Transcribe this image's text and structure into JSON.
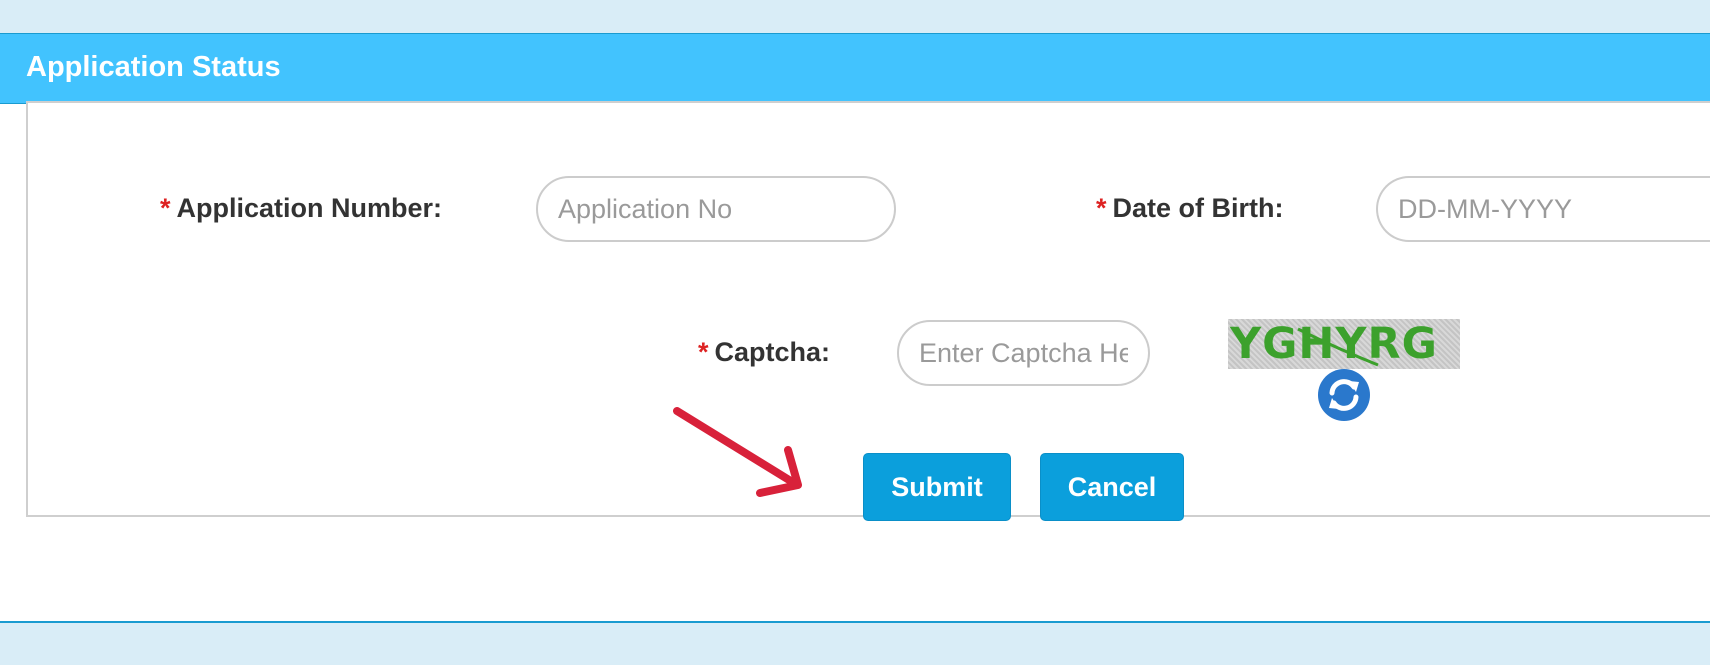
{
  "panel": {
    "title": "Application Status"
  },
  "form": {
    "required_marker": "*",
    "application_number": {
      "label": "Application Number:",
      "placeholder": "Application No",
      "value": ""
    },
    "date_of_birth": {
      "label": "Date of Birth:",
      "placeholder": "DD-MM-YYYY",
      "value": ""
    },
    "captcha": {
      "label": "Captcha:",
      "placeholder": "Enter Captcha Here",
      "value": "",
      "image_text": "YGHYRG",
      "image_text_color": "#3ca12c"
    },
    "refresh_icon": "refresh-icon",
    "buttons": {
      "submit": "Submit",
      "cancel": "Cancel"
    }
  },
  "annotation": {
    "icon": "arrow-icon",
    "color": "#d8213a"
  },
  "colors": {
    "page_background": "#d9edf7",
    "header_background": "#42c3fe",
    "button_background": "#0b9fdc",
    "required_marker": "#dd2222"
  }
}
